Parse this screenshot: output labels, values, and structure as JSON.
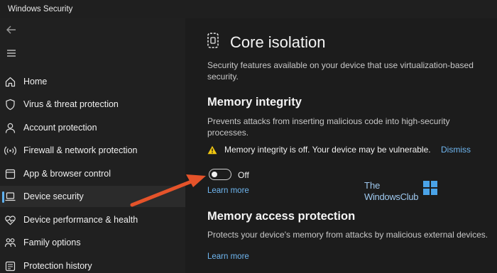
{
  "window": {
    "title": "Windows Security"
  },
  "sidebar": {
    "items": [
      {
        "label": "Home",
        "icon": "home-icon",
        "active": false
      },
      {
        "label": "Virus & threat protection",
        "icon": "shield-icon",
        "active": false
      },
      {
        "label": "Account protection",
        "icon": "person-icon",
        "active": false
      },
      {
        "label": "Firewall & network protection",
        "icon": "wifi-signal-icon",
        "active": false
      },
      {
        "label": "App & browser control",
        "icon": "app-window-icon",
        "active": false
      },
      {
        "label": "Device security",
        "icon": "laptop-icon",
        "active": true
      },
      {
        "label": "Device performance & health",
        "icon": "heart-icon",
        "active": false
      },
      {
        "label": "Family options",
        "icon": "family-icon",
        "active": false
      },
      {
        "label": "Protection history",
        "icon": "history-icon",
        "active": false
      }
    ]
  },
  "main": {
    "title": "Core isolation",
    "description": "Security features available on your device that use virtualization-based security.",
    "memory_integrity": {
      "title": "Memory integrity",
      "description": "Prevents attacks from inserting malicious code into high-security processes.",
      "warning": "Memory integrity is off. Your device may be vulnerable.",
      "dismiss": "Dismiss",
      "toggle_state": "Off",
      "learn_more": "Learn more"
    },
    "memory_access": {
      "title": "Memory access protection",
      "description": "Protects your device's memory from attacks by malicious external devices.",
      "learn_more": "Learn more"
    }
  },
  "watermark": {
    "line1": "The",
    "line2": "WindowsClub"
  },
  "colors": {
    "accent": "#5fb2f2",
    "link": "#6fb6f0",
    "warning": "#f2c811",
    "annotation_arrow": "#e5532a",
    "background": "#1c1c1c",
    "sidebar": "#202020"
  }
}
